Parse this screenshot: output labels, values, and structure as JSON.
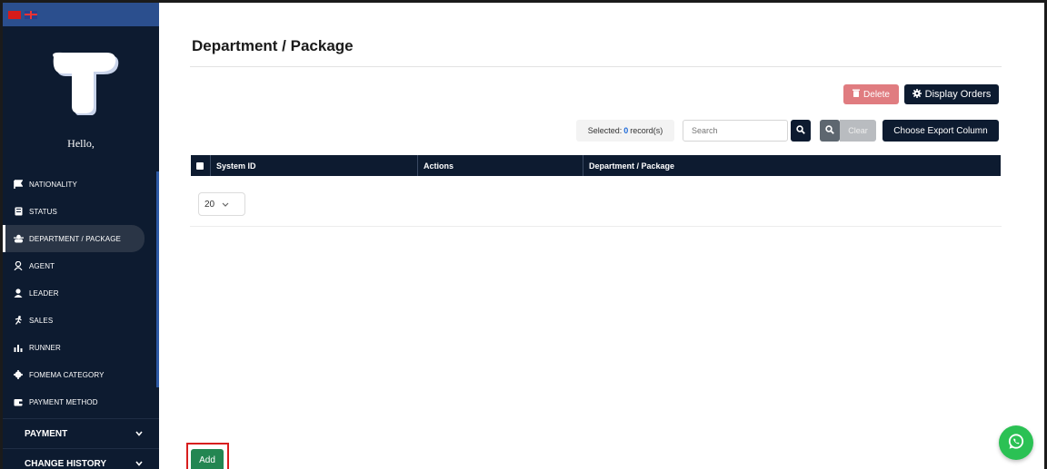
{
  "sidebar": {
    "flags": [
      "china-flag",
      "uk-flag"
    ],
    "greeting": "Hello,",
    "items": [
      {
        "label": "NATIONALITY",
        "icon": "flag-icon"
      },
      {
        "label": "STATUS",
        "icon": "id-badge-icon"
      },
      {
        "label": "DEPARTMENT / PACKAGE",
        "icon": "users-icon",
        "active": true
      },
      {
        "label": "AGENT",
        "icon": "user-tie-icon"
      },
      {
        "label": "LEADER",
        "icon": "user-icon"
      },
      {
        "label": "SALES",
        "icon": "person-running-icon"
      },
      {
        "label": "RUNNER",
        "icon": "chart-user-icon"
      },
      {
        "label": "FOMEMA CATEGORY",
        "icon": "gear-icon"
      },
      {
        "label": "PAYMENT METHOD",
        "icon": "wallet-icon"
      }
    ],
    "groups": [
      {
        "label": "PAYMENT",
        "icon": "chevron-down-icon"
      },
      {
        "label": "CHANGE HISTORY",
        "icon": "chevron-down-icon"
      }
    ]
  },
  "main": {
    "title": "Department / Package",
    "toolbar": {
      "delete_label": "Delete",
      "display_orders_label": "Display Orders",
      "selected_prefix": "Selected:",
      "selected_count": "0",
      "selected_suffix": "record(s)",
      "search_placeholder": "Search",
      "clear_label": "Clear",
      "export_label": "Choose Export Column"
    },
    "table": {
      "columns": [
        "System ID",
        "Actions",
        "Department / Package"
      ],
      "rows": []
    },
    "page_size": "20",
    "add_label": "Add"
  },
  "colors": {
    "sidebar_bg": "#0d1b30",
    "flag_bar": "#2b4f8e",
    "delete": "#e07c80",
    "add": "#238652",
    "whatsapp": "#2bc154",
    "highlight": "#d81e1e"
  }
}
